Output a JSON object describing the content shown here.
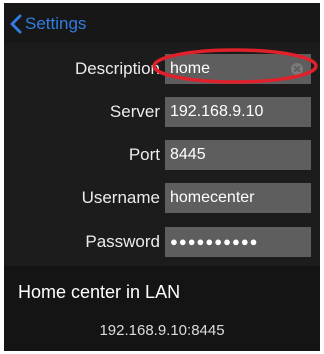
{
  "nav": {
    "back_label": "Settings",
    "accent_color": "#2f7de1"
  },
  "form": {
    "rows": [
      {
        "label": "Description",
        "value": "home"
      },
      {
        "label": "Server",
        "value": "192.168.9.10"
      },
      {
        "label": "Port",
        "value": "8445"
      },
      {
        "label": "Username",
        "value": "homecenter"
      },
      {
        "label": "Password",
        "value": "●●●●●●●●●●"
      }
    ]
  },
  "section": {
    "title": "Home center in LAN",
    "address": "192.168.9.10:8445"
  },
  "highlight": {
    "color": "#e0202a"
  }
}
